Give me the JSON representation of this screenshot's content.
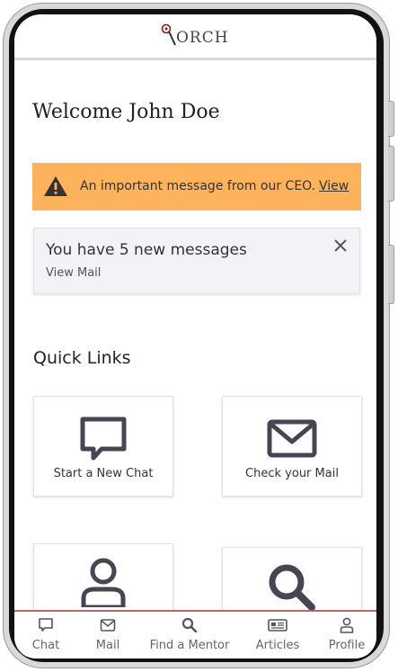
{
  "header": {
    "logo_text": "ORCH"
  },
  "welcome": {
    "text": "Welcome John Doe"
  },
  "ceo_alert": {
    "message": "An important message from our CEO.",
    "link_label": "View",
    "color": "#fcb35b"
  },
  "messages_alert": {
    "title": "You have 5 new messages",
    "link_label": "View Mail"
  },
  "quick_links": {
    "title": "Quick Links",
    "items": [
      {
        "label": "Start a New Chat",
        "icon": "chat-icon"
      },
      {
        "label": "Check your Mail",
        "icon": "mail-icon"
      },
      {
        "label": "",
        "icon": "profile-icon"
      },
      {
        "label": "",
        "icon": "search-icon"
      }
    ]
  },
  "bottom_nav": {
    "items": [
      {
        "label": "Chat",
        "icon": "chat-icon"
      },
      {
        "label": "Mail",
        "icon": "mail-icon"
      },
      {
        "label": "Find a Mentor",
        "icon": "search-icon"
      },
      {
        "label": "Articles",
        "icon": "newspaper-icon"
      },
      {
        "label": "Profile",
        "icon": "profile-icon"
      }
    ]
  },
  "colors": {
    "icon_dark": "#4a4452",
    "accent_line": "#b56a6a"
  }
}
